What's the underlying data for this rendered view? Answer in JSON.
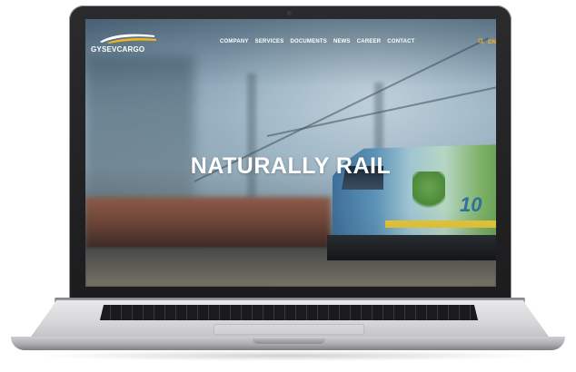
{
  "brand": {
    "name": "GYSEVCARGO",
    "logo_icon": "train-swoosh-icon",
    "colors": {
      "accent": "#f2b51d",
      "swoosh_white": "#ffffff",
      "swoosh_yellow": "#f2b51d"
    }
  },
  "nav": {
    "items": [
      {
        "label": "COMPANY"
      },
      {
        "label": "SERVICES"
      },
      {
        "label": "DOCUMENTS"
      },
      {
        "label": "NEWS"
      },
      {
        "label": "CAREER"
      },
      {
        "label": "CONTACT"
      }
    ],
    "search_icon": "search-icon",
    "language": "EN"
  },
  "hero": {
    "title": "NATURALLY RAIL",
    "locomotive_text": "10"
  }
}
